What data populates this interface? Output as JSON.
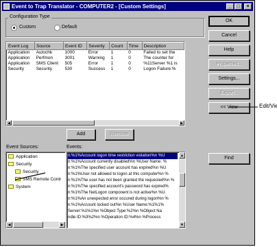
{
  "window": {
    "title": "Event to Trap Translator - COMPUTER2 - [Custom Settings]"
  },
  "titlebar_buttons": {
    "minimize": "_",
    "maximize": "□",
    "close": "×"
  },
  "config": {
    "group_label": "Configuration Type",
    "options": [
      {
        "label": "Custom",
        "selected": true
      },
      {
        "label": "Default",
        "selected": false
      }
    ]
  },
  "table": {
    "columns": [
      "Event Log",
      "Source",
      "Event ID",
      "Severity",
      "Count",
      "Time",
      "Description"
    ],
    "rows": [
      [
        "Application",
        "Autochk",
        "1000",
        "Error",
        "1",
        "0",
        "Failed to set the"
      ],
      [
        "Application",
        "Perfmon",
        "3001",
        "Warning",
        "1",
        "0",
        "The counter for"
      ],
      [
        "Application",
        "SMS Client",
        "505",
        "Error",
        "1",
        "0",
        "%11Server %1 is"
      ],
      [
        "Security",
        "Security",
        "530",
        "Success",
        "1",
        "0",
        "Logon Failure:%"
      ]
    ]
  },
  "buttons": {
    "ok": "OK",
    "cancel": "Cancel",
    "help": "Help",
    "properties": "Properties...",
    "settings": "Settings...",
    "export": "Export...",
    "view": "<< View",
    "add": "Add",
    "remove": "Remove",
    "find": "Find"
  },
  "annotation": {
    "label": "Edit/View"
  },
  "sources": {
    "label": "Event Sources:",
    "items": [
      {
        "label": "Application",
        "level": 0
      },
      {
        "label": "Security",
        "level": 0
      },
      {
        "label": "Security",
        "level": 1
      },
      {
        "label": "SMS Remote Contr",
        "level": 1
      },
      {
        "label": "System",
        "level": 0
      }
    ]
  },
  "events": {
    "label": "Events:",
    "lines": [
      "n:%1%Account logon time restriction violation%n  %U",
      "n:%1%Account currently disabled%n  %User Name: %",
      "n:%1%The specified user account has expired%n  %U",
      "n:%1%User not allowed to logon at this computer%n  %",
      "n:%1%The user has not been granted the requested%n  %",
      "n:%1%The specified account's password has expired%",
      "n:%1%The NetLogon component is not active%n  %U",
      "n:%1%An unexpected error occured during logon%n  %",
      "n:%1%Account locked out%n  %User Name:%1%1%",
      "Server:%1%1%n  %Object Type:%2%n  %Object Na",
      "ndle ID:%3%2%n  %Operation ID:%4%n  %Process"
    ]
  }
}
